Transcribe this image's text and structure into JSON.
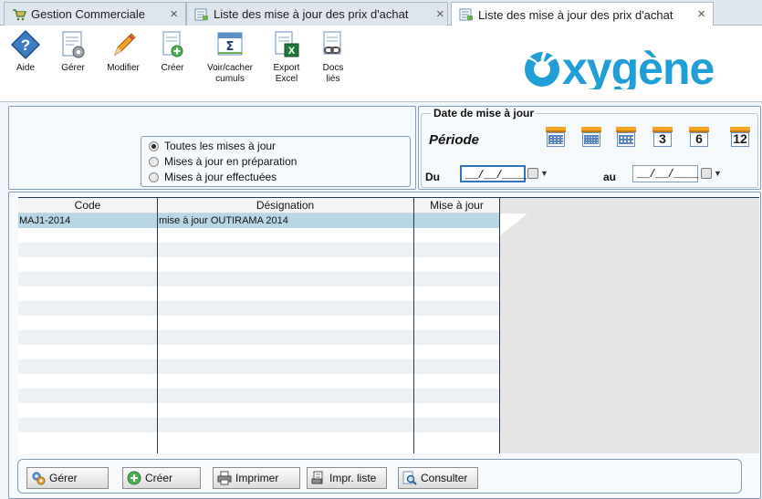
{
  "tabs": [
    {
      "label": "Gestion Commerciale",
      "icon": "cart-icon"
    },
    {
      "label": "Liste des mise à jour des prix d'achat",
      "icon": "list-icon"
    },
    {
      "label": "Liste des mise à jour des prix d'achat",
      "icon": "list-icon",
      "active": true
    }
  ],
  "tab_close_glyph": "×",
  "toolbar": {
    "aide": "Aide",
    "gerer": "Gérer",
    "modifier": "Modifier",
    "creer": "Créer",
    "voir_line1": "Voir/cacher",
    "voir_line2": "cumuls",
    "export_line1": "Export",
    "export_line2": "Excel",
    "docs_line1": "Docs",
    "docs_line2": "liés"
  },
  "logo_text": "xygène",
  "filter": {
    "options": [
      "Toutes les mises à jour",
      "Mises à jour en préparation",
      "Mises à jour effectuées"
    ],
    "selected": 0
  },
  "date_panel": {
    "legend": "Date de mise à jour",
    "periode": "Période",
    "cal_numbers": [
      "3",
      "6",
      "12"
    ],
    "du_label": "Du",
    "au_label": "au",
    "du_value": "__/__/____",
    "au_value": "__/__/____"
  },
  "table": {
    "headers": [
      "Code",
      "Désignation",
      "Mise à jour"
    ],
    "rows": [
      {
        "code": "MAJ1-2014",
        "designation": "mise à jour OUTIRAMA 2014",
        "mise_a_jour": ""
      }
    ]
  },
  "buttons": {
    "gerer": "Gérer",
    "creer": "Créer",
    "imprimer": "Imprimer",
    "impr_liste": "Impr. liste",
    "consulter": "Consulter"
  },
  "colors": {
    "selected_row": "#b8d7e6",
    "logo_blue": "#1f9fd6",
    "border": "#7f9db9"
  }
}
